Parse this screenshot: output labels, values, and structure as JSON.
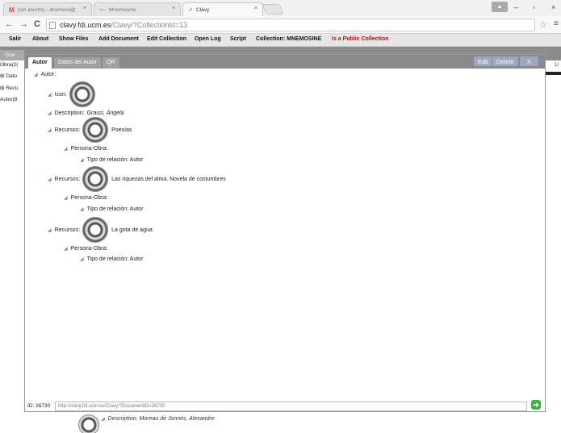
{
  "browser": {
    "tabs": [
      {
        "icon": "gmail-icon",
        "glyph": "M",
        "label": "(sin asunto) - dromerol@",
        "close": "×"
      },
      {
        "icon": "page-icon",
        "glyph": "〰",
        "label": "Mnemosine",
        "close": "×"
      },
      {
        "icon": "app-icon",
        "glyph": "♂",
        "label": "Clavy",
        "close": "×"
      }
    ],
    "url_host": "clavy.fdi.ucm.es",
    "url_path": "/Clavy/?CollectionId=13",
    "nav": {
      "back": "←",
      "forward": "→",
      "reload": "C"
    },
    "star": "☆",
    "menu": "≡",
    "profile": "▲",
    "minimize": "–",
    "restore": "▫",
    "close": "×"
  },
  "toolbar": {
    "salir": "Salir",
    "about": "About",
    "show_files": "Show Files",
    "add_document": "Add Document",
    "edit_collection": "Edit Collection",
    "open_log": "Open Log",
    "script": "Script",
    "collection": "Collection: MNEMOSINE",
    "public": "Is a Public Collection"
  },
  "background": {
    "top_tab": "Grar",
    "left_items": [
      "Obra(2(",
      "⊞ Dato",
      "⊞ Recu",
      "Autor(8"
    ],
    "right_number": "1/",
    "bottom_description": "Description: Moreau de Jonnès, Alexandre"
  },
  "modal": {
    "tabs": [
      "Autor",
      "Datos del Autor",
      "QR"
    ],
    "buttons": {
      "edit": "Edit",
      "delete": "Delete",
      "close": "X"
    },
    "tree": {
      "autor": "Autor:",
      "icon": "Icon:",
      "description_label": "Description:",
      "description_value": "Grassi, Ángela",
      "recursos": [
        {
          "label": "Recursos:",
          "title": "Poesías",
          "persona_obra": "Persona-Obra:",
          "tipo": "Tipo de relación: Autor"
        },
        {
          "label": "Recursos:",
          "title": "Las riquezas del alma. Novela de costumbres",
          "persona_obra": "Persona-Obra:",
          "tipo": "Tipo de relación: Autor"
        },
        {
          "label": "Recursos:",
          "title": "La gota de agua",
          "persona_obra": "Persona-Obra:",
          "tipo": "Tipo de relación: Autor"
        }
      ]
    },
    "footer": {
      "id_label": "ID: 26730",
      "url_value": "http://clavy.fdi.ucm.es/Clavy/?DocumentID=26730",
      "go": "➜"
    }
  },
  "colors": {
    "public_collection": "#b01414",
    "tree_triangle": "#6aa84f",
    "go_button": "#3fb33f",
    "modal_header": "#8a8a8a"
  }
}
